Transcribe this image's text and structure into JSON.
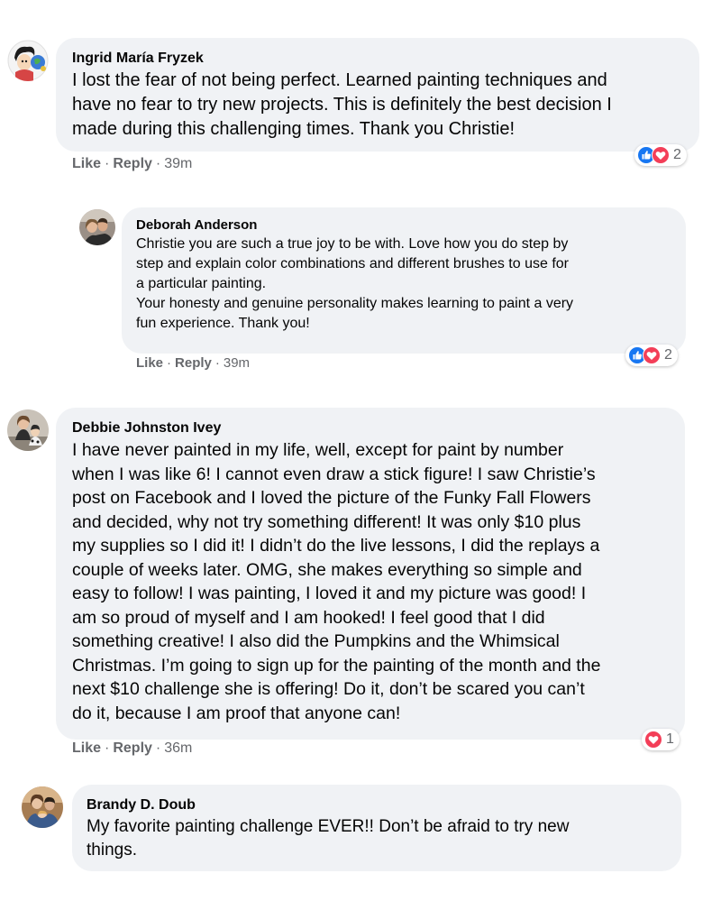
{
  "comments": [
    {
      "author": "Ingrid María Fryzek",
      "text": "I lost the fear of not being perfect. Learned painting techniques and\nhave no fear to try new projects. This is definitely the best decision I\nmade during this challenging times. Thank you Christie!",
      "actions": {
        "like": "Like",
        "reply": "Reply",
        "separator": "·",
        "time": "39m"
      },
      "reactions": {
        "icons": [
          "like-icon",
          "love-icon"
        ],
        "count": "2"
      }
    },
    {
      "author": "Deborah Anderson",
      "text": "Christie you are such a true joy to be with. Love how you do step by\nstep and explain color combinations and different brushes to use for\na particular painting.\nYour honesty and genuine personality makes learning to paint a very\nfun experience. Thank you!",
      "actions": {
        "like": "Like",
        "reply": "Reply",
        "separator": "·",
        "time": "39m"
      },
      "reactions": {
        "icons": [
          "like-icon",
          "love-icon"
        ],
        "count": "2"
      }
    },
    {
      "author": "Debbie Johnston Ivey",
      "text": "I have never painted in my life, well, except for paint by number\nwhen I was like 6! I cannot even draw a stick figure! I saw Christie’s\npost on Facebook and I loved the picture of the Funky Fall Flowers\nand decided, why not try something different! It was only $10 plus\nmy supplies so I did it! I didn’t do the live lessons, I did the replays a\ncouple of weeks later. OMG, she makes everything so simple and\neasy to follow! I was painting, I loved it and my picture was good! I\nam so proud of myself and I am hooked! I feel good that I did\nsomething creative! I also did the Pumpkins and the Whimsical\nChristmas. I’m going to sign up for the painting of the month and the\nnext $10 challenge she is offering! Do it, don’t be scared you can’t\ndo it, because I am proof that anyone can!",
      "actions": {
        "like": "Like",
        "reply": "Reply",
        "separator": "·",
        "time": "36m"
      },
      "reactions": {
        "icons": [
          "love-icon"
        ],
        "count": "1"
      }
    },
    {
      "author": "Brandy D. Doub",
      "text": "My favorite painting challenge EVER!! Don’t be afraid to try new\nthings."
    }
  ],
  "colors": {
    "bubble": "#f0f2f5",
    "meta": "#65676b",
    "like_blue": "#1877f2",
    "love_red": "#f33e58"
  }
}
